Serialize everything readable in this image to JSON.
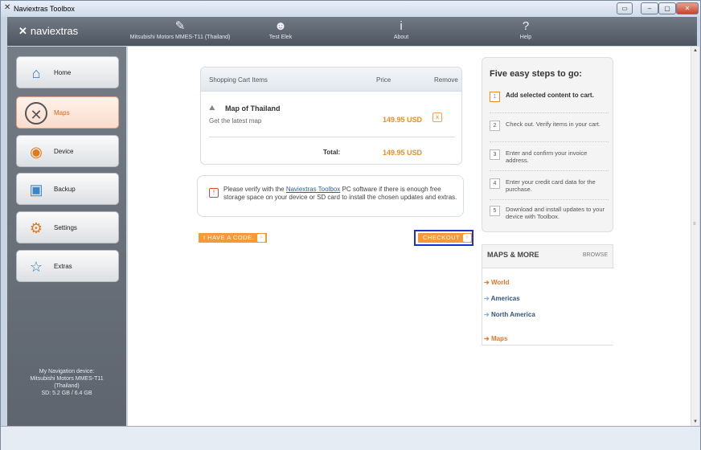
{
  "window": {
    "title": "Naviextras Toolbox"
  },
  "toolbar": {
    "brand": "naviextras",
    "device": "Mitsubishi Motors MMES-T11 (Thailand)",
    "user": "Test Elek",
    "about": "About",
    "help": "Help"
  },
  "sidebar": {
    "items": [
      {
        "label": "Home"
      },
      {
        "label": "Maps"
      },
      {
        "label": "Device"
      },
      {
        "label": "Backup"
      },
      {
        "label": "Settings"
      },
      {
        "label": "Extras"
      }
    ],
    "device_info": [
      "My Navigation device:",
      "Mitsubishi Motors MMES-T11",
      "(Thailand)",
      "SD: 5.2 GB / 6.4 GB"
    ]
  },
  "cart": {
    "header_items": "Shopping Cart Items",
    "header_price": "Price",
    "header_remove": "Remove",
    "item_name": "Map of Thailand",
    "item_desc": "Get the latest map",
    "item_price": "149.95 USD",
    "remove_symbol": "x",
    "total_label": "Total:",
    "total_price": "149.95 USD"
  },
  "notice": {
    "pre": "Please verify with the ",
    "link": "Naviextras Toolbox",
    "post": " PC software if there is enough free storage space on your device or SD card to install the chosen updates and extras."
  },
  "buttons": {
    "code": "I HAVE A CODE.",
    "checkout": "CHECKOUT"
  },
  "steps": {
    "title": "Five easy steps to go:",
    "items": [
      {
        "n": "1",
        "text": "Add selected content to cart."
      },
      {
        "n": "2",
        "text": "Check out. Verify items in your cart."
      },
      {
        "n": "3",
        "text": "Enter and confirm your invoice address."
      },
      {
        "n": "4",
        "text": "Enter your credit card data for the purchase."
      },
      {
        "n": "5",
        "text": "Download and install updates to your device with Toolbox."
      }
    ]
  },
  "maps": {
    "title": "MAPS & MORE",
    "browse": "BROWSE",
    "links": [
      "World",
      "Americas",
      "North America",
      "Maps"
    ]
  }
}
